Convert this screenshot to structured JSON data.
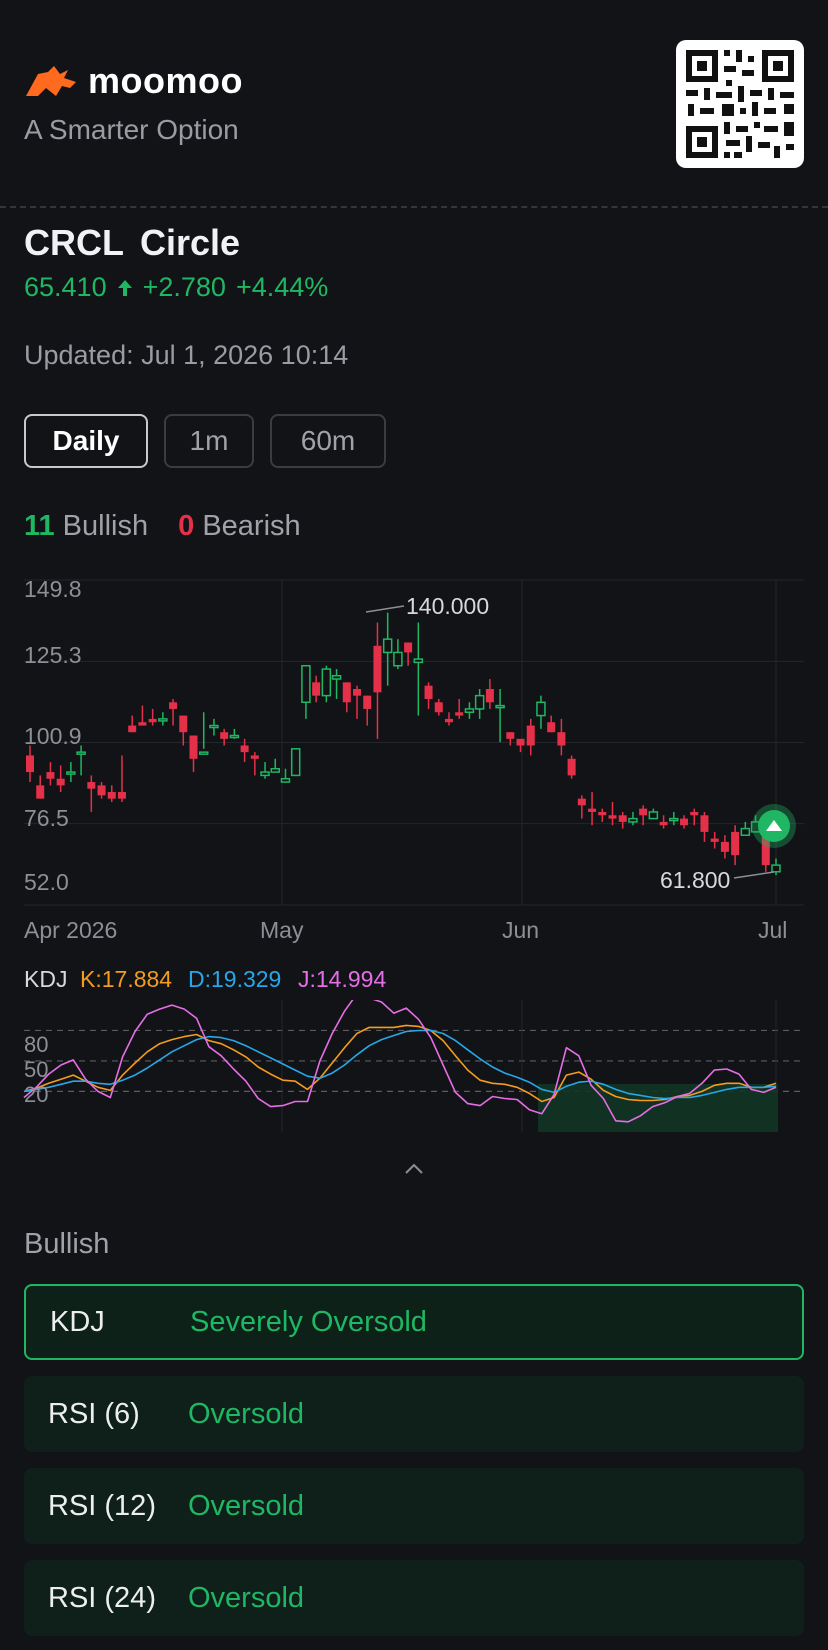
{
  "header": {
    "brand": "moomoo",
    "tagline": "A Smarter Option"
  },
  "stock": {
    "ticker": "CRCL",
    "name": "Circle",
    "price": "65.410",
    "change": "+2.780",
    "change_pct": "+4.44%",
    "direction_icon": "up-arrow-icon"
  },
  "updated": "Updated: Jul 1, 2026 10:14",
  "tabs": [
    {
      "label": "Daily",
      "active": true
    },
    {
      "label": "1m",
      "active": false
    },
    {
      "label": "60m",
      "active": false
    }
  ],
  "signals": {
    "bullish_count": "11",
    "bullish_label": "Bullish",
    "bearish_count": "0",
    "bearish_label": "Bearish"
  },
  "colors": {
    "up": "#1fb763",
    "down": "#e5304a",
    "k": "#f39c1f",
    "d": "#27a7e8",
    "j": "#e56ee6"
  },
  "chart_data": [
    {
      "type": "candlestick",
      "y_ticks": [
        "149.8",
        "125.3",
        "100.9",
        "76.5",
        "52.0"
      ],
      "ylim": [
        52.0,
        149.8
      ],
      "x_ticks": [
        "Apr 2026",
        "May",
        "Jun",
        "Jul"
      ],
      "annotations": {
        "high": "140.000",
        "low": "61.800"
      },
      "candles": [
        [
          97,
          100,
          92,
          89
        ],
        [
          88,
          91,
          84,
          85
        ],
        [
          92,
          95,
          90,
          88
        ],
        [
          90,
          94,
          88,
          86
        ],
        [
          92,
          95,
          92,
          89
        ],
        [
          98,
          100,
          98,
          91
        ],
        [
          89,
          91,
          87,
          80
        ],
        [
          88,
          89,
          85,
          84
        ],
        [
          86,
          88,
          84,
          83
        ],
        [
          86,
          97,
          84,
          83
        ],
        [
          106,
          109,
          104,
          104
        ],
        [
          107,
          112,
          106,
          106
        ],
        [
          108,
          111,
          107,
          106
        ],
        [
          108,
          110,
          108,
          106
        ],
        [
          113,
          114,
          111,
          106
        ],
        [
          109,
          109,
          104,
          100
        ],
        [
          103,
          103,
          96,
          92
        ],
        [
          98,
          110,
          98,
          99
        ],
        [
          106,
          108,
          106,
          103
        ],
        [
          104,
          105,
          102,
          100
        ],
        [
          103,
          105,
          103,
          102
        ],
        [
          100,
          102,
          98,
          95
        ],
        [
          97,
          98,
          96,
          91
        ],
        [
          91,
          95,
          92,
          90
        ],
        [
          92,
          96,
          93,
          93
        ],
        [
          89,
          93,
          90,
          89
        ],
        [
          91,
          98,
          99,
          91
        ],
        [
          113,
          121,
          124,
          108
        ],
        [
          119,
          121,
          115,
          113
        ],
        [
          115,
          124,
          123,
          113
        ],
        [
          120,
          123,
          121,
          114
        ],
        [
          119,
          119,
          113,
          110
        ],
        [
          117,
          118,
          115,
          108
        ],
        [
          115,
          115,
          111,
          106
        ],
        [
          130,
          137,
          116,
          102
        ],
        [
          128,
          140,
          132,
          118
        ],
        [
          124,
          132,
          128,
          123
        ],
        [
          131,
          131,
          128,
          124
        ],
        [
          125,
          137,
          126,
          109
        ],
        [
          118,
          119,
          114,
          111
        ],
        [
          113,
          114,
          110,
          109
        ],
        [
          108,
          110,
          107,
          106
        ],
        [
          110,
          114,
          109,
          108
        ],
        [
          110,
          113,
          111,
          108
        ],
        [
          111,
          117,
          115,
          108
        ],
        [
          117,
          120,
          113,
          111
        ],
        [
          112,
          117,
          112,
          101
        ],
        [
          104,
          104,
          102,
          100
        ],
        [
          102,
          102,
          100,
          98
        ],
        [
          106,
          108,
          100,
          97
        ],
        [
          109,
          115,
          113,
          105
        ],
        [
          107,
          109,
          104,
          104
        ],
        [
          104,
          108,
          100,
          97
        ],
        [
          96,
          97,
          91,
          90
        ],
        [
          84,
          85,
          82,
          78
        ],
        [
          81,
          86,
          80,
          76
        ],
        [
          80,
          81,
          79,
          77
        ],
        [
          79,
          83,
          78,
          76
        ],
        [
          79,
          80,
          77,
          75
        ],
        [
          77,
          80,
          78,
          76
        ],
        [
          81,
          82,
          79,
          76
        ],
        [
          78,
          81,
          80,
          79
        ],
        [
          77,
          79,
          76,
          75
        ],
        [
          78,
          80,
          78,
          76
        ],
        [
          78,
          79,
          76,
          75
        ],
        [
          80,
          81,
          79,
          76
        ],
        [
          79,
          80,
          74,
          71
        ],
        [
          72,
          74,
          71,
          69
        ],
        [
          71,
          73,
          68,
          66
        ],
        [
          74,
          76,
          67,
          64
        ],
        [
          73,
          77,
          75,
          74
        ],
        [
          74,
          79,
          77,
          74
        ],
        [
          75,
          77,
          64,
          62
        ],
        [
          62,
          66,
          64,
          61
        ]
      ]
    },
    {
      "type": "line",
      "title": "KDJ",
      "series_labels": {
        "k": "K:17.884",
        "d": "D:19.329",
        "j": "J:14.994"
      },
      "y_ticks": [
        "80",
        "50",
        "20"
      ],
      "ylim": [
        -20,
        110
      ],
      "series": [
        {
          "name": "K",
          "values": [
            20,
            23,
            28,
            32,
            36,
            30,
            24,
            21,
            36,
            48,
            59,
            67,
            71,
            74,
            76,
            70,
            67,
            61,
            54,
            44,
            37,
            31,
            30,
            22,
            33,
            48,
            63,
            77,
            83,
            83,
            83,
            85,
            84,
            80,
            70,
            55,
            41,
            31,
            28,
            27,
            24,
            18,
            10,
            14,
            36,
            39,
            32,
            21,
            15,
            12,
            11,
            11,
            12,
            15,
            16,
            20,
            26,
            28,
            28,
            24,
            24,
            28
          ]
        },
        {
          "name": "D",
          "values": [
            20,
            22,
            24,
            27,
            30,
            30,
            28,
            27,
            31,
            36,
            43,
            51,
            59,
            65,
            71,
            74,
            73,
            70,
            65,
            59,
            53,
            47,
            41,
            35,
            33,
            38,
            46,
            56,
            65,
            71,
            75,
            79,
            80,
            80,
            77,
            70,
            61,
            52,
            44,
            38,
            34,
            29,
            22,
            19,
            25,
            29,
            30,
            27,
            22,
            18,
            16,
            14,
            13,
            14,
            14,
            16,
            19,
            22,
            24,
            24,
            24,
            25
          ]
        },
        {
          "name": "J",
          "values": [
            14,
            24,
            37,
            46,
            51,
            32,
            20,
            14,
            54,
            79,
            96,
            101,
            105,
            101,
            92,
            64,
            55,
            42,
            30,
            13,
            5,
            6,
            10,
            10,
            50,
            77,
            99,
            116,
            112,
            108,
            97,
            102,
            91,
            73,
            46,
            19,
            8,
            6,
            15,
            13,
            12,
            2,
            -2,
            17,
            63,
            55,
            26,
            13,
            -9,
            -10,
            -4,
            5,
            9,
            15,
            18,
            28,
            41,
            42,
            37,
            22,
            19,
            24
          ]
        }
      ]
    }
  ],
  "collapse_icon": "chevron-up-icon",
  "bullish_section": {
    "label": "Bullish",
    "items": [
      {
        "name": "KDJ",
        "value": "Severely Oversold"
      },
      {
        "name": "RSI (6)",
        "value": "Oversold"
      },
      {
        "name": "RSI (12)",
        "value": "Oversold"
      },
      {
        "name": "RSI (24)",
        "value": "Oversold"
      }
    ]
  }
}
